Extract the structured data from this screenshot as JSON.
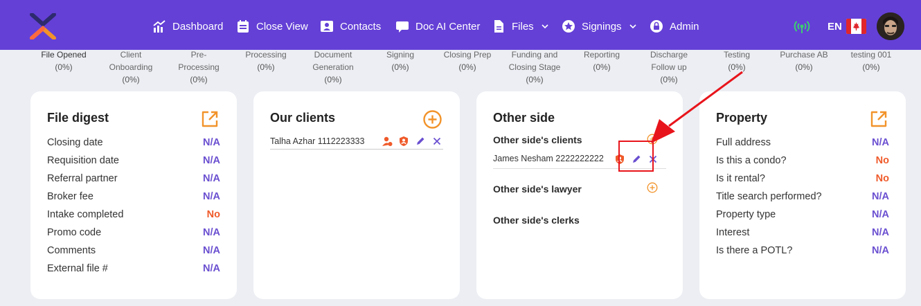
{
  "nav": {
    "items": [
      {
        "label": "Dashboard",
        "icon": "chart-icon"
      },
      {
        "label": "Close View",
        "icon": "calendar-icon"
      },
      {
        "label": "Contacts",
        "icon": "contact-card-icon"
      },
      {
        "label": "Doc AI Center",
        "icon": "chat-icon"
      },
      {
        "label": "Files",
        "icon": "file-icon",
        "dropdown": true
      },
      {
        "label": "Signings",
        "icon": "star-badge-icon",
        "dropdown": true
      },
      {
        "label": "Admin",
        "icon": "lock-icon"
      }
    ],
    "language": "EN"
  },
  "stages": [
    {
      "name": "File Opened",
      "pct": "(0%)"
    },
    {
      "name": "Client Onboarding",
      "pct": "(0%)"
    },
    {
      "name": "Pre-Processing",
      "pct": "(0%)"
    },
    {
      "name": "Processing",
      "pct": "(0%)"
    },
    {
      "name": "Document Generation",
      "pct": "(0%)"
    },
    {
      "name": "Signing",
      "pct": "(0%)"
    },
    {
      "name": "Closing Prep",
      "pct": "(0%)"
    },
    {
      "name": "Funding and Closing Stage",
      "pct": "(0%)"
    },
    {
      "name": "Reporting",
      "pct": "(0%)"
    },
    {
      "name": "Discharge Follow up",
      "pct": "(0%)"
    },
    {
      "name": "Testing",
      "pct": "(0%)"
    },
    {
      "name": "Purchase AB",
      "pct": "(0%)"
    },
    {
      "name": "testing 001",
      "pct": "(0%)"
    }
  ],
  "file_digest": {
    "title": "File digest",
    "rows": [
      {
        "label": "Closing date",
        "value": "N/A"
      },
      {
        "label": "Requisition date",
        "value": "N/A"
      },
      {
        "label": "Referral partner",
        "value": "N/A"
      },
      {
        "label": "Broker fee",
        "value": "N/A"
      },
      {
        "label": "Intake completed",
        "value": "No"
      },
      {
        "label": "Promo code",
        "value": "N/A"
      },
      {
        "label": "Comments",
        "value": "N/A"
      },
      {
        "label": "External file #",
        "value": "N/A"
      }
    ]
  },
  "our_clients": {
    "title": "Our clients",
    "clients": [
      {
        "name": "Talha Azhar 1112223333"
      }
    ]
  },
  "other_side": {
    "title": "Other side",
    "clients_title": "Other side's clients",
    "clients": [
      {
        "name": "James Nesham 2222222222"
      }
    ],
    "lawyer_title": "Other side's lawyer",
    "clerks_title": "Other side's clerks"
  },
  "property": {
    "title": "Property",
    "rows": [
      {
        "label": "Full address",
        "value": "N/A"
      },
      {
        "label": "Is this a condo?",
        "value": "No"
      },
      {
        "label": "Is it rental?",
        "value": "No"
      },
      {
        "label": "Title search performed?",
        "value": "N/A"
      },
      {
        "label": "Property type",
        "value": "N/A"
      },
      {
        "label": "Interest",
        "value": "N/A"
      },
      {
        "label": "Is there a POTL?",
        "value": "N/A"
      }
    ]
  },
  "colors": {
    "nav": "#6440d6",
    "accent_orange": "#f2932a",
    "value_purple": "#6a4fd0",
    "value_no": "#ef5a2a",
    "annotation_red": "#e8141b"
  }
}
